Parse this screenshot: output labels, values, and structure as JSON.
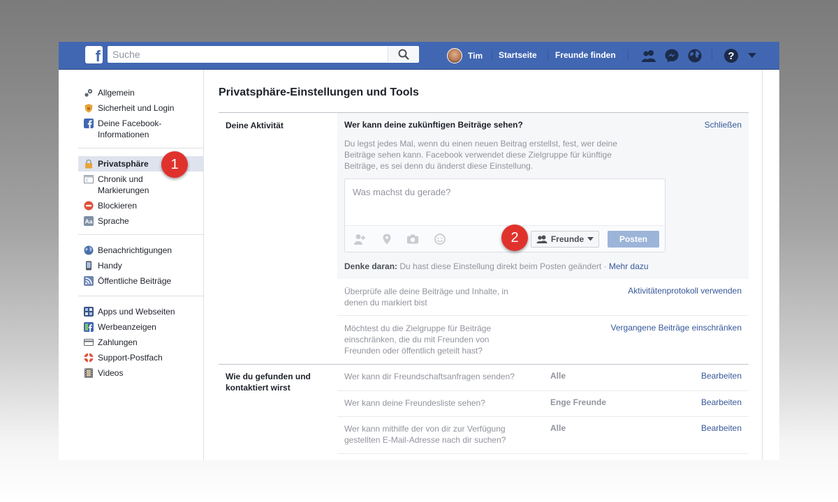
{
  "header": {
    "logo": "f",
    "search_placeholder": "Suche",
    "user_name": "Tim",
    "nav": [
      "Startseite",
      "Freunde finden"
    ]
  },
  "sidebar": {
    "groups": [
      [
        {
          "label": "Allgemein",
          "icon": "gear-icon"
        },
        {
          "label": "Sicherheit und Login",
          "icon": "shield-icon"
        },
        {
          "label": "Deine Facebook-Informationen",
          "icon": "facebook-icon"
        }
      ],
      [
        {
          "label": "Privatsphäre",
          "icon": "lock-icon",
          "active": true
        },
        {
          "label": "Chronik und Markierungen",
          "icon": "timeline-icon"
        },
        {
          "label": "Blockieren",
          "icon": "block-icon"
        },
        {
          "label": "Sprache",
          "icon": "language-icon"
        }
      ],
      [
        {
          "label": "Benachrichtigungen",
          "icon": "globe-icon"
        },
        {
          "label": "Handy",
          "icon": "mobile-icon"
        },
        {
          "label": "Öffentliche Beiträge",
          "icon": "rss-icon"
        }
      ],
      [
        {
          "label": "Apps und Webseiten",
          "icon": "apps-icon"
        },
        {
          "label": "Werbeanzeigen",
          "icon": "ads-icon"
        },
        {
          "label": "Zahlungen",
          "icon": "card-icon"
        },
        {
          "label": "Support-Postfach",
          "icon": "lifebuoy-icon"
        },
        {
          "label": "Videos",
          "icon": "film-icon"
        }
      ]
    ]
  },
  "main": {
    "title": "Privatsphäre-Einstellungen und Tools",
    "section1": {
      "label": "Deine Aktivität",
      "expanded_title": "Wer kann deine zukünftigen Beiträge sehen?",
      "close_label": "Schließen",
      "description": "Du legst jedes Mal, wenn du einen neuen Beitrag erstellst, fest, wer deine Beiträge sehen kann. Facebook verwendet diese Zielgruppe für künftige Beiträge, es sei denn du änderst diese Einstellung.",
      "composer_placeholder": "Was machst du gerade?",
      "audience_label": "Freunde",
      "post_label": "Posten",
      "reminder_bold": "Denke daran:",
      "reminder_text": " Du hast diese Einstellung direkt beim Posten geändert · ",
      "reminder_link": "Mehr dazu",
      "rows": [
        {
          "text": "Überprüfe alle deine Beiträge und Inhalte, in denen du markiert bist",
          "link": "Aktivitätenprotokoll verwenden"
        },
        {
          "text": "Möchtest du die Zielgruppe für Beiträge einschränken, die du mit Freunden von Freunden oder öffentlich geteilt hast?",
          "link": "Vergangene Beiträge einschränken"
        }
      ]
    },
    "section2": {
      "label": "Wie du gefunden und kontaktiert wirst",
      "rows": [
        {
          "text": "Wer kann dir Freundschaftsanfragen senden?",
          "value": "Alle",
          "link": "Bearbeiten"
        },
        {
          "text": "Wer kann deine Freundesliste sehen?",
          "value": "Enge Freunde",
          "link": "Bearbeiten"
        },
        {
          "text": "Wer kann mithilfe der von dir zur Verfügung gestellten E-Mail-Adresse nach dir suchen?",
          "value": "Alle",
          "link": "Bearbeiten"
        }
      ]
    }
  },
  "annotations": [
    "1",
    "2"
  ],
  "colors": {
    "brand": "#4267b2",
    "link": "#365899",
    "badge": "#e0322d"
  }
}
